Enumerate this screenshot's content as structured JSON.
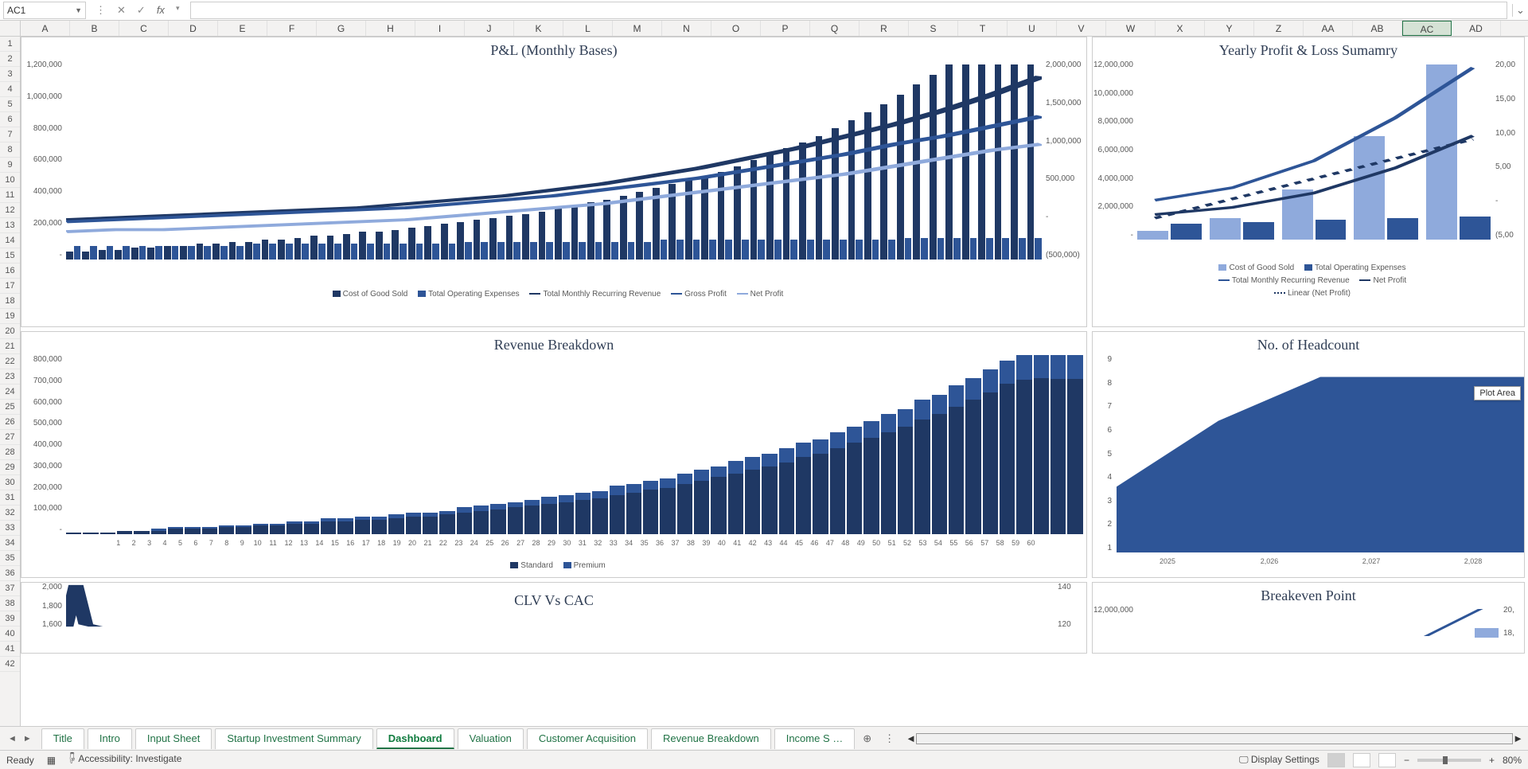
{
  "nameBox": "AC1",
  "selectedCol": "AC",
  "columns": [
    "A",
    "B",
    "C",
    "D",
    "E",
    "F",
    "G",
    "H",
    "I",
    "J",
    "K",
    "L",
    "M",
    "N",
    "O",
    "P",
    "Q",
    "R",
    "S",
    "T",
    "U",
    "V",
    "W",
    "X",
    "Y",
    "Z",
    "AA",
    "AB",
    "AC",
    "AD"
  ],
  "rowCount": 42,
  "tabs": [
    "Title",
    "Intro",
    "Input Sheet",
    "Startup Investment Summary",
    "Dashboard",
    "Valuation",
    "Customer Acquisition",
    "Revenue Breakdown",
    "Income S …"
  ],
  "activeTab": "Dashboard",
  "status": {
    "ready": "Ready",
    "access": "Accessibility: Investigate",
    "display": "Display Settings",
    "zoom": "80%"
  },
  "tooltip": "Plot Area",
  "chart_data": [
    {
      "id": "pnl",
      "type": "combo",
      "title": "P&L (Monthly Bases)",
      "y_left_ticks": [
        "1,200,000",
        "1,000,000",
        "800,000",
        "600,000",
        "400,000",
        "200,000",
        "-"
      ],
      "y_right_ticks": [
        "2,000,000",
        "1,500,000",
        "1,000,000",
        "500,000",
        "-",
        "(500,000)"
      ],
      "legend": [
        "Cost of Good Sold",
        "Total Operating Expenses",
        "Total Monthly Recurring Revenue",
        "Gross Profit",
        "Net Profit"
      ],
      "months": 60,
      "series": {
        "cogs_pct": [
          4,
          4,
          5,
          5,
          6,
          6,
          7,
          7,
          8,
          8,
          9,
          9,
          10,
          10,
          11,
          12,
          12,
          13,
          14,
          14,
          15,
          16,
          17,
          18,
          19,
          20,
          21,
          22,
          23,
          24,
          26,
          27,
          29,
          30,
          32,
          34,
          36,
          38,
          40,
          42,
          44,
          47,
          50,
          53,
          56,
          59,
          62,
          66,
          70,
          74,
          78,
          83,
          88,
          93,
          98,
          98,
          98,
          98,
          98,
          98
        ],
        "opex_pct": [
          7,
          7,
          7,
          7,
          7,
          7,
          7,
          7,
          7,
          7,
          7,
          8,
          8,
          8,
          8,
          8,
          8,
          8,
          8,
          8,
          8,
          8,
          8,
          8,
          9,
          9,
          9,
          9,
          9,
          9,
          9,
          9,
          9,
          9,
          9,
          9,
          10,
          10,
          10,
          10,
          10,
          10,
          10,
          10,
          10,
          10,
          10,
          10,
          10,
          10,
          10,
          11,
          11,
          11,
          11,
          11,
          11,
          11,
          11,
          11
        ],
        "revenue_poly": "0,80 5,79 10,78 15,77 20,76 25,75 30,74 35,72 40,70 45,68 50,65 55,62 60,58 65,54 70,49 75,44 80,38 85,32 90,25 95,17 100,8",
        "gross_poly": "0,81 5,80 10,79 15,78 20,77 25,76 30,75 35,74 40,72 45,70 50,68 55,65 60,62 65,59 70,55 75,51 80,47 85,42 90,38 95,33 100,28",
        "net_poly": "0,86 5,85 10,85 15,84 20,83 25,82 30,81 35,80 40,78 45,76 50,74 55,72 60,69 65,66 70,63 75,60 80,57 85,53 90,49 95,45 100,42"
      }
    },
    {
      "id": "yearly",
      "type": "combo",
      "title": "Yearly Profit & Loss Sumamry",
      "y_left_ticks": [
        "12,000,000",
        "10,000,000",
        "8,000,000",
        "6,000,000",
        "4,000,000",
        "2,000,000",
        "-"
      ],
      "y_right_ticks": [
        "20,00",
        "15,00",
        "10,00",
        "5,00",
        "-",
        "(5,00"
      ],
      "categories": [
        "",
        "",
        "",
        "",
        ""
      ],
      "legend": [
        "Cost of Good Sold",
        "Total Operating Expenses",
        "Total Monthly Recurring Revenue",
        "Net Profit",
        "Linear (Net Profit)"
      ],
      "series": {
        "cogs_pct": [
          5,
          12,
          28,
          58,
          98
        ],
        "opex_pct": [
          9,
          10,
          11,
          12,
          13
        ],
        "revenue_poly": "5,78 27,71 50,56 73,32 95,4",
        "net_poly": "5,86 27,82 50,74 73,60 95,42",
        "linear_poly": "5,88 95,44"
      }
    },
    {
      "id": "rev",
      "type": "bar",
      "title": "Revenue Breakdown",
      "y_left_ticks": [
        "800,000",
        "700,000",
        "600,000",
        "500,000",
        "400,000",
        "300,000",
        "200,000",
        "100,000",
        "-"
      ],
      "x_labels": [
        1,
        2,
        3,
        4,
        5,
        6,
        7,
        8,
        9,
        10,
        11,
        12,
        13,
        14,
        15,
        16,
        17,
        18,
        19,
        20,
        21,
        22,
        23,
        24,
        25,
        26,
        27,
        28,
        29,
        30,
        31,
        32,
        33,
        34,
        35,
        36,
        37,
        38,
        39,
        40,
        41,
        42,
        43,
        44,
        45,
        46,
        47,
        48,
        49,
        50,
        51,
        52,
        53,
        54,
        55,
        56,
        57,
        58,
        59,
        60
      ],
      "legend": [
        "Standard",
        "Premium"
      ],
      "series": {
        "standard_pct": [
          1,
          1,
          1,
          2,
          2,
          2,
          3,
          3,
          3,
          4,
          4,
          5,
          5,
          6,
          6,
          7,
          7,
          8,
          8,
          9,
          10,
          10,
          11,
          12,
          13,
          14,
          15,
          16,
          17,
          18,
          19,
          20,
          22,
          23,
          25,
          26,
          28,
          30,
          32,
          34,
          36,
          38,
          40,
          43,
          45,
          48,
          51,
          54,
          57,
          60,
          64,
          67,
          71,
          75,
          79,
          84,
          88,
          93,
          97,
          97
        ],
        "premium_pct": [
          0,
          0,
          0,
          0,
          0,
          1,
          1,
          1,
          1,
          1,
          1,
          1,
          1,
          1,
          1,
          2,
          2,
          2,
          2,
          2,
          2,
          2,
          2,
          3,
          3,
          3,
          3,
          3,
          4,
          4,
          4,
          4,
          5,
          5,
          5,
          5,
          6,
          6,
          6,
          7,
          7,
          7,
          8,
          8,
          8,
          9,
          9,
          9,
          10,
          10,
          11,
          11,
          12,
          12,
          13,
          13,
          14,
          14,
          15,
          15
        ]
      }
    },
    {
      "id": "head",
      "type": "area",
      "title": "No. of Headcount",
      "y_left_ticks": [
        "9",
        "8",
        "7",
        "6",
        "5",
        "4",
        "3",
        "2",
        "1"
      ],
      "x_labels": [
        "2025",
        "2,026",
        "2,027",
        "2,028"
      ],
      "values": [
        3,
        6,
        8,
        8,
        8
      ]
    },
    {
      "id": "clv",
      "type": "combo",
      "title": "CLV Vs CAC",
      "y_left_ticks": [
        "2,000",
        "1,800",
        "1,600"
      ],
      "y_right_ticks": [
        "140",
        "120"
      ]
    },
    {
      "id": "break",
      "type": "combo",
      "title": "Breakeven Point",
      "y_left_ticks": [
        "12,000,000",
        ""
      ],
      "y_right_ticks": [
        "20,",
        "18,"
      ]
    }
  ]
}
